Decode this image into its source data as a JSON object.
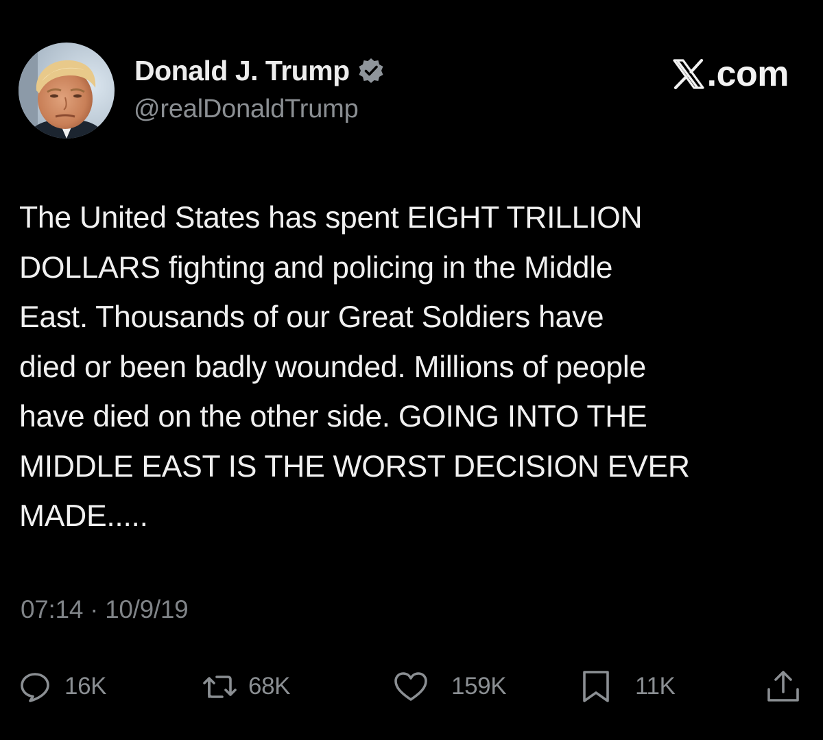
{
  "author": {
    "name": "Donald J. Trump",
    "handle": "@realDonaldTrump",
    "verified_icon": "verified-badge-icon"
  },
  "brand": {
    "text": ".com",
    "logo_icon": "x-logo-icon"
  },
  "tweet": {
    "text": "The United States has spent EIGHT TRILLION\nDOLLARS fighting and policing in the Middle\nEast. Thousands of our Great Soldiers have\ndied or been badly wounded. Millions of people\nhave died on the other side. GOING INTO THE\nMIDDLE EAST IS THE WORST DECISION EVER\nMADE.....",
    "timestamp": "07:14 · 10/9/19"
  },
  "actions": {
    "reply": {
      "icon": "reply-icon",
      "count": "16K"
    },
    "retweet": {
      "icon": "retweet-icon",
      "count": "68K"
    },
    "like": {
      "icon": "heart-icon",
      "count": "159K"
    },
    "bookmark": {
      "icon": "bookmark-icon",
      "count": "11K"
    },
    "share": {
      "icon": "share-icon"
    }
  },
  "colors": {
    "background": "#000000",
    "text": "#e7e9ea",
    "muted": "#808488",
    "verified": "#8f959b"
  }
}
